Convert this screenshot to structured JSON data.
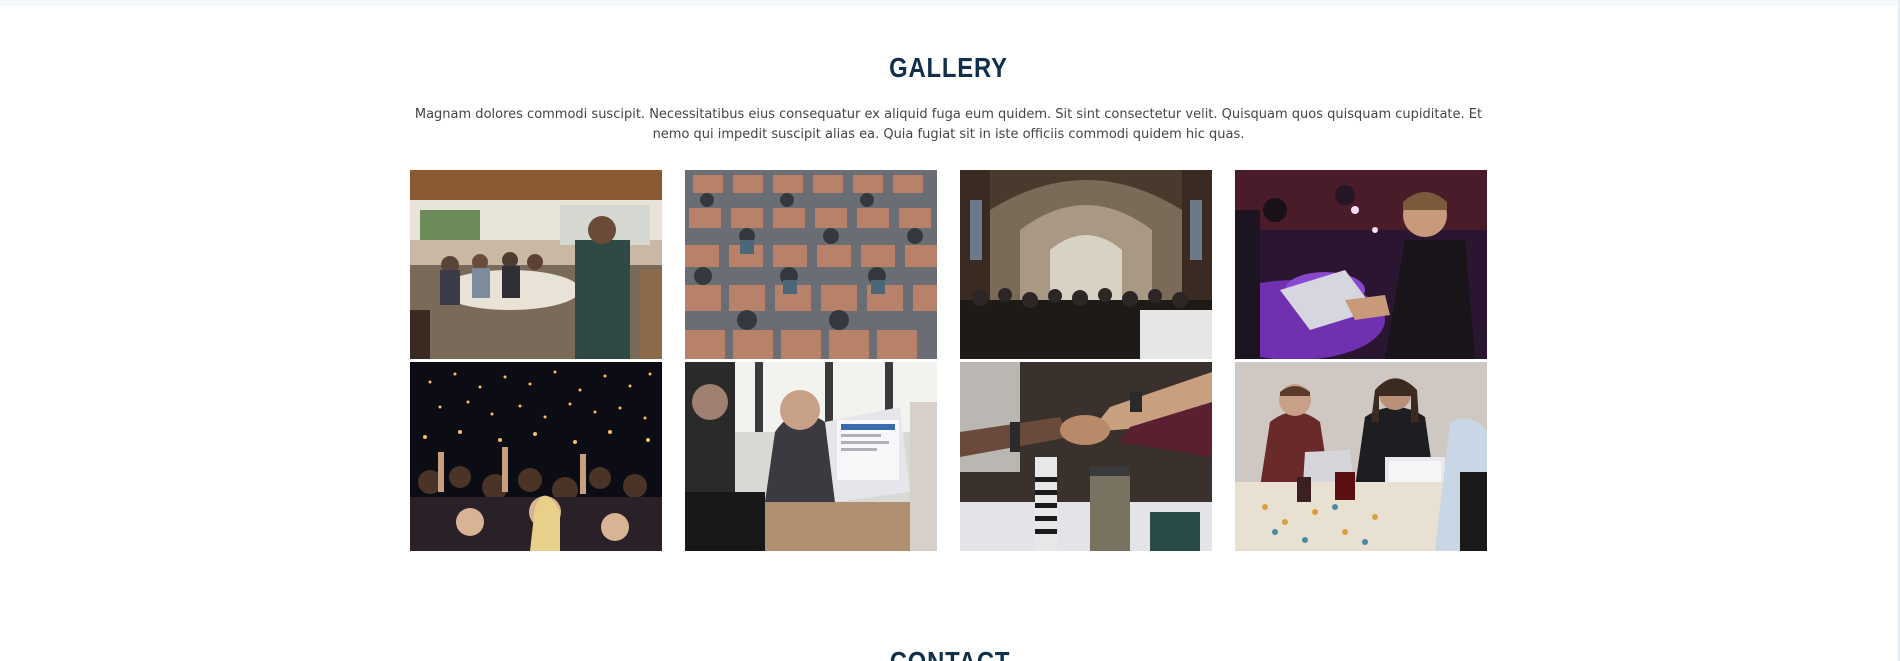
{
  "gallery": {
    "title": "GALLERY",
    "description": "Magnam dolores commodi suscipit. Necessitatibus eius consequatur ex aliquid fuga eum quidem. Sit sint consectetur velit. Quisquam quos quisquam cupiditate. Et nemo qui impedit suscipit alias ea. Quia fugiat sit in iste officiis commodi quidem hic quas.",
    "images": [
      {
        "subject": "speaker-at-restaurant-event"
      },
      {
        "subject": "audience-in-auditorium-seats"
      },
      {
        "subject": "crowded-exhibition-hall"
      },
      {
        "subject": "man-with-laptop-at-hackathon"
      },
      {
        "subject": "concert-crowd-with-lights"
      },
      {
        "subject": "business-meeting-with-laptop"
      },
      {
        "subject": "handshake-over-table"
      },
      {
        "subject": "team-working-with-laptops"
      }
    ]
  },
  "next_section": {
    "title": "CONTACT"
  },
  "colors": {
    "title": "#0f2f4a",
    "text": "#444444",
    "top_strip": "#f2f8fc"
  }
}
